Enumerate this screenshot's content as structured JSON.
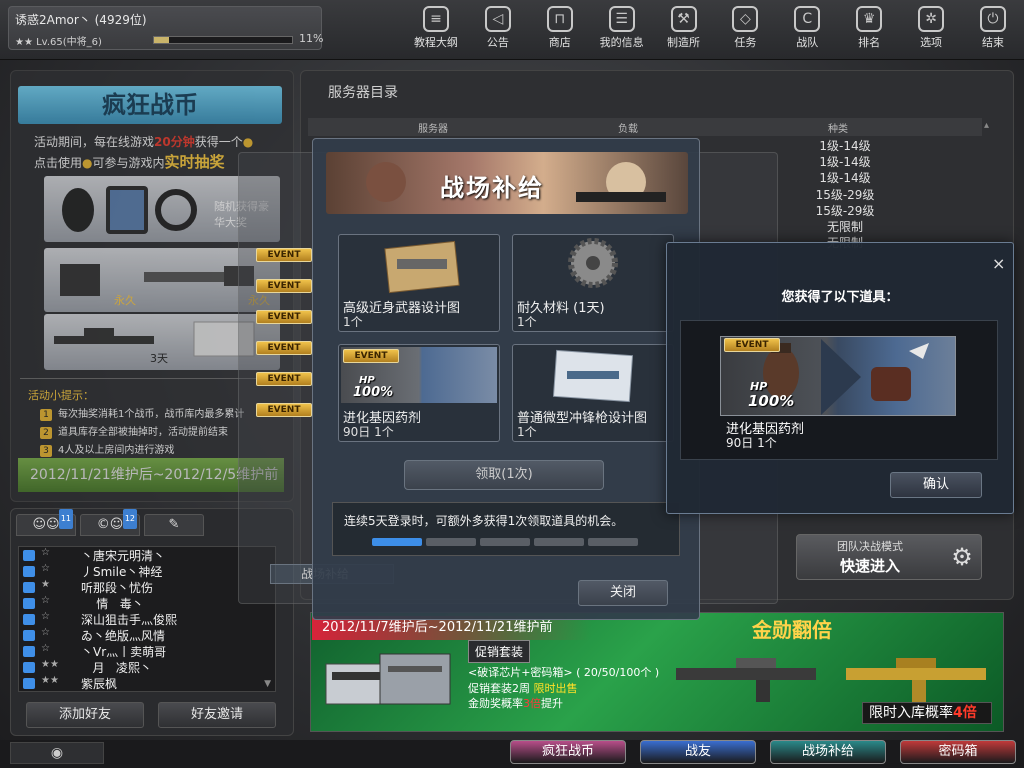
{
  "player": {
    "name": "诱惑2Amor丶 (4929位)",
    "level": "★★ Lv.65(中将_6)",
    "xp_fraction": 0.11,
    "xp_percent": "11%"
  },
  "topnav": [
    {
      "label": "教程大纲",
      "icon": "book-icon"
    },
    {
      "label": "公告",
      "icon": "speaker-icon"
    },
    {
      "label": "商店",
      "icon": "shop-icon"
    },
    {
      "label": "我的信息",
      "icon": "profile-card-icon"
    },
    {
      "label": "制造所",
      "icon": "forge-icon"
    },
    {
      "label": "任务",
      "icon": "ticket-icon"
    },
    {
      "label": "战队",
      "icon": "shield-icon"
    },
    {
      "label": "排名",
      "icon": "trophy-icon"
    },
    {
      "label": "选项",
      "icon": "gear-icon"
    },
    {
      "label": "结束",
      "icon": "power-icon"
    }
  ],
  "event_panel": {
    "title": "疯狂战币",
    "desc_prefix": "活动期间，每在线游戏",
    "desc_minutes": "20分钟",
    "desc_mid": "获得一个",
    "desc_line2": "点击使用",
    "desc_line2b": "可参与游戏内",
    "desc_highlight": "实时抽奖",
    "prize1": "随机获得豪华大奖",
    "prize2_left": "永久",
    "prize2_right": "永久",
    "prize3": "3天",
    "tips_title": "活动小提示：",
    "tips": [
      "每次抽奖消耗1个战币，战币库内最多累计",
      "道具库存全部被抽掉时，活动提前结束",
      "4人及以上房间内进行游戏"
    ],
    "date": "2012/11/21维护后~2012/12/5维护前"
  },
  "friends": {
    "tab_badges": [
      "11",
      "12"
    ],
    "list": [
      {
        "status": "☆",
        "name": "丶唐宋元明清丶"
      },
      {
        "status": "☆",
        "name": "丿Smile丶神经"
      },
      {
        "status": "★",
        "name": "听那段丶忧伤"
      },
      {
        "status": "☆",
        "name": "    情   毒丶"
      },
      {
        "status": "☆",
        "name": "深山狙击手灬俊熙"
      },
      {
        "status": "☆",
        "name": "ゐ丶绝版灬风情"
      },
      {
        "status": "☆",
        "name": "丶Vr灬丨卖萌哥"
      },
      {
        "status": "★★",
        "name": "   月   凌熙丶"
      },
      {
        "status": "★★",
        "name": "紫辰枫"
      }
    ],
    "add_friend": "添加好友",
    "invite_friend": "好友邀请"
  },
  "server_list": {
    "title": "服务器目录",
    "headers": [
      "服务器",
      "负载",
      "种类"
    ],
    "levels": [
      "1级-14级",
      "1级-14级",
      "1级-14级",
      "15级-29级",
      "15级-29级",
      "无限制",
      "无限制"
    ]
  },
  "quick_join": {
    "mode": "团队决战模式",
    "action": "快速进入"
  },
  "banner": {
    "date": "2012/11/7维护后~2012/11/21维护前",
    "headline": "金勋翻倍",
    "promo_badge": "促销套装",
    "line1": "<破译芯片+密码箱> ( 20/50/100个 )",
    "line2_a": "促销套装2周",
    "line2_b": "限时出售",
    "line3_a": "金勋奖概率",
    "line3_b": "3倍",
    "line3_c": "提升",
    "limited_a": "限时入库概率",
    "limited_b": "4倍"
  },
  "bottom_nav": [
    {
      "label": "疯狂战币",
      "color": "#b84e8a"
    },
    {
      "label": "战友",
      "color": "#3a6ed0"
    },
    {
      "label": "战场补给",
      "color": "#2a8a8a"
    },
    {
      "label": "密码箱",
      "color": "#c03a3a"
    }
  ],
  "supply": {
    "title": "战场补给",
    "items": [
      {
        "name": "高级近身武器设计图",
        "qty": "1个"
      },
      {
        "name": "耐久材料 (1天)",
        "qty": "1个"
      },
      {
        "name": "进化基因药剂",
        "qty": "90日 1个"
      },
      {
        "name": "普通微型冲锋枪设计图",
        "qty": "1个"
      }
    ],
    "claim": "领取(1次)",
    "login_tip": "连续5天登录时，可额外多获得1次领取道具的机会。",
    "login_days_total": 5,
    "login_days_done": 1,
    "close": "关闭",
    "side_tags": [
      "EVENT",
      "EVENT",
      "EVENT",
      "EVENT",
      "EVENT",
      "EVENT"
    ],
    "bg_tab": "战场补给"
  },
  "reward": {
    "title": "您获得了以下道具：",
    "tag": "EVENT",
    "hp_label": "HP",
    "hp_value": "100%",
    "name": "进化基因药剂",
    "qty": "90日 1个",
    "confirm": "确认",
    "close": "×"
  },
  "event_tag": "EVENT",
  "hp_small": "HP",
  "hp_small_value": "100%"
}
